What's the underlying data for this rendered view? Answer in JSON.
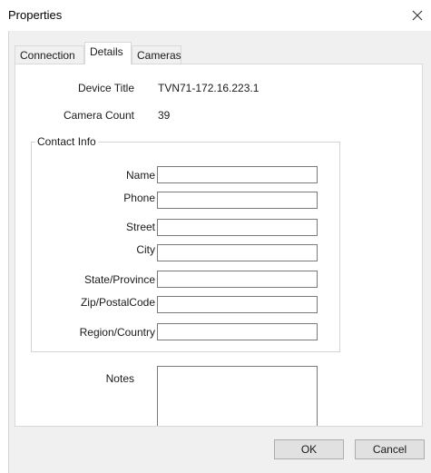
{
  "window": {
    "title": "Properties"
  },
  "tabs": [
    {
      "label": "Connection"
    },
    {
      "label": "Details"
    },
    {
      "label": "Cameras"
    }
  ],
  "details": {
    "device_title_label": "Device Title",
    "device_title_value": "TVN71-172.16.223.1",
    "camera_count_label": "Camera Count",
    "camera_count_value": "39"
  },
  "contact_info": {
    "legend": "Contact Info",
    "fields": [
      {
        "label": "Name",
        "value": ""
      },
      {
        "label": "Phone",
        "value": ""
      },
      {
        "label": "Street",
        "value": ""
      },
      {
        "label": "City",
        "value": ""
      },
      {
        "label": "State/Province",
        "value": ""
      },
      {
        "label": "Zip/PostalCode",
        "value": ""
      },
      {
        "label": "Region/Country",
        "value": ""
      }
    ]
  },
  "notes": {
    "label": "Notes",
    "value": ""
  },
  "buttons": {
    "ok": "OK",
    "cancel": "Cancel"
  }
}
